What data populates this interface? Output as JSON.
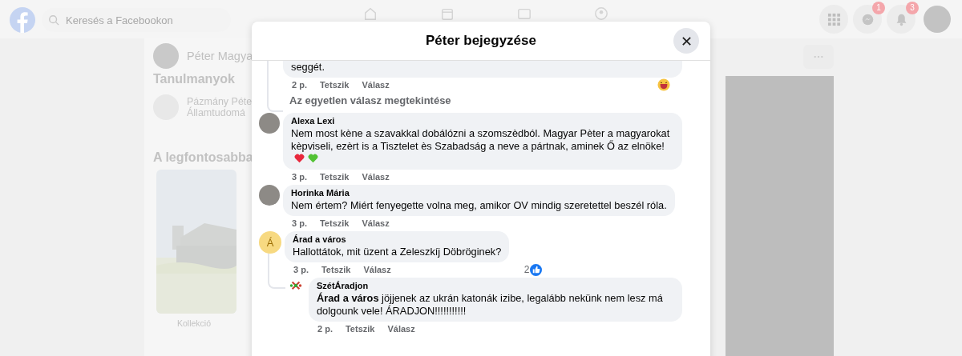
{
  "topbar": {
    "search": {
      "placeholder": "Keresés a Facebookon"
    },
    "notifications": [
      {
        "kind": "messenger",
        "badge": "1"
      },
      {
        "kind": "bell",
        "badge": "3"
      }
    ]
  },
  "background": {
    "profile_name": "Péter Magya",
    "section_title": "Tanulmanyok",
    "school": [
      "Pázmány Péte",
      "Államtudomá"
    ],
    "highlights_title": "A legfontosabba",
    "collection_label": "Kollekció"
  },
  "dialog": {
    "title": "Péter bejegyzése",
    "comments": [
      {
        "kind": "fragment",
        "text": "seggét.",
        "time": "2 p.",
        "actions": [
          "Tetszik",
          "Válasz"
        ],
        "reaction": {
          "kind": "haha"
        }
      },
      {
        "kind": "more_replies",
        "text": "Az egyetlen válasz megtekintése"
      },
      {
        "kind": "comment",
        "author": "Alexa Lexi",
        "text": "Nem most kène a szavakkal dobálózni a szomszèdból. Magyar Pèter a magyarokat kèpviseli, ezèrt is a Tisztelet ès Szabadság a neve a pártnak, aminek Ő az elnöke!",
        "hearts": [
          {
            "color": "#e8283c"
          },
          {
            "color": "#52c234"
          }
        ],
        "time": "3 p.",
        "actions": [
          "Tetszik",
          "Válasz"
        ]
      },
      {
        "kind": "comment",
        "author": "Horinka Mária",
        "text": "Nem értem? Miért fenyegette volna meg, amikor OV mindig szeretettel beszél róla.",
        "time": "3 p.",
        "actions": [
          "Tetszik",
          "Válasz"
        ]
      },
      {
        "kind": "comment",
        "author": "Árad a város",
        "avatar": {
          "kind": "letter",
          "letter": "Á"
        },
        "text": "Hallottátok, mit üzent a Zeleszkíj Döbröginek?",
        "time": "3 p.",
        "actions": [
          "Tetszik",
          "Válasz"
        ],
        "likes": "2",
        "children": [
          {
            "kind": "comment",
            "author": "SzétÁradjon",
            "avatar": {
              "kind": "logo"
            },
            "text": "**Árad a város** jöjjenek az ukrán katonák izibe, legalább nekünk nem lesz má dolgounk vele! ÁRADJON!!!!!!!!!!!",
            "time": "2 p.",
            "actions": [
              "Tetszik",
              "Válasz"
            ]
          }
        ]
      }
    ]
  }
}
